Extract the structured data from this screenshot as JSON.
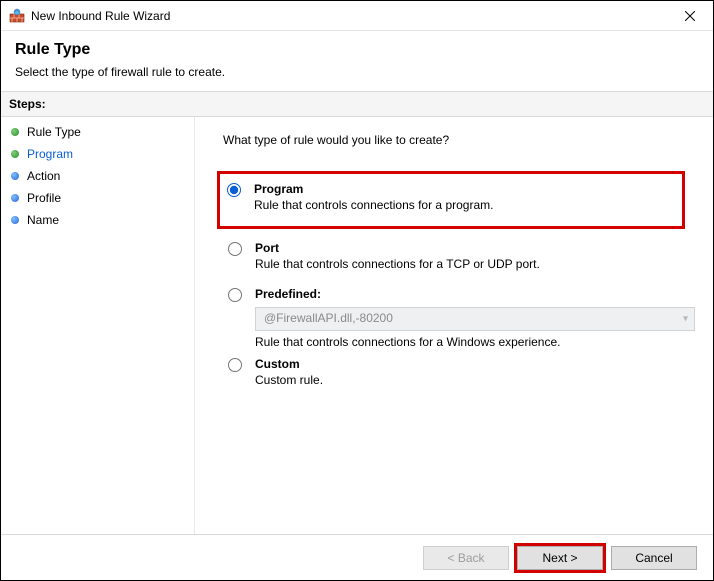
{
  "window": {
    "title": "New Inbound Rule Wizard"
  },
  "header": {
    "title": "Rule Type",
    "subtitle": "Select the type of firewall rule to create."
  },
  "stepsLabel": "Steps:",
  "steps": [
    {
      "label": "Rule Type",
      "current": false
    },
    {
      "label": "Program",
      "current": true
    },
    {
      "label": "Action",
      "current": false
    },
    {
      "label": "Profile",
      "current": false
    },
    {
      "label": "Name",
      "current": false
    }
  ],
  "main": {
    "prompt": "What type of rule would you like to create?",
    "options": {
      "program": {
        "label": "Program",
        "desc": "Rule that controls connections for a program.",
        "selected": true
      },
      "port": {
        "label": "Port",
        "desc": "Rule that controls connections for a TCP or UDP port.",
        "selected": false
      },
      "predefined": {
        "label": "Predefined:",
        "combo": "@FirewallAPI.dll,-80200",
        "desc": "Rule that controls connections for a Windows experience.",
        "selected": false
      },
      "custom": {
        "label": "Custom",
        "desc": "Custom rule.",
        "selected": false
      }
    }
  },
  "footer": {
    "back": "< Back",
    "next": "Next >",
    "cancel": "Cancel"
  }
}
